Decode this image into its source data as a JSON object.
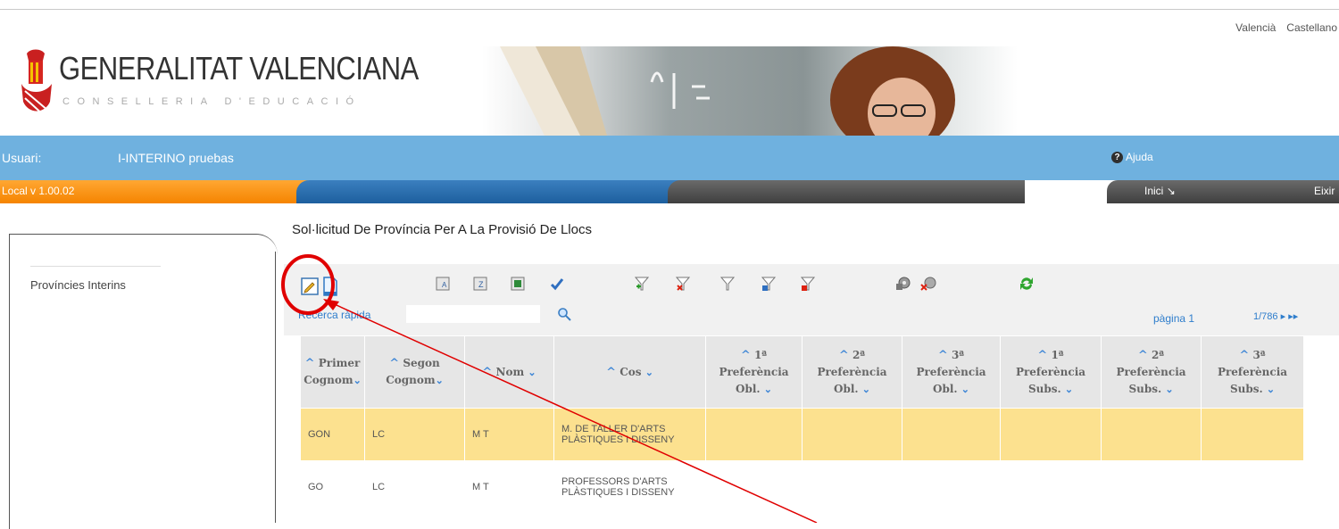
{
  "top": {
    "languages": [
      "Valencià",
      "Castellano"
    ]
  },
  "header": {
    "logo_title": "GENERALITAT VALENCIANA",
    "logo_subtitle": "CONSELLERIA D'EDUCACIÓ"
  },
  "userbar": {
    "user_label": "Usuari:",
    "user_name": "I-INTERINO pruebas",
    "help_label": "Ajuda"
  },
  "tabs": {
    "version": "Local v 1.00.02",
    "inici": "Inici",
    "eixir": "Eixir"
  },
  "sidebar": {
    "items": [
      {
        "label": "Províncies Interins"
      }
    ]
  },
  "main": {
    "title": "Sol·licitud De Província Per A La Provisió De Llocs"
  },
  "toolbar": {
    "icons": [
      "edit-icon",
      "new-document-icon",
      "export-icon",
      "sort-icon",
      "excel-icon",
      "check-icon",
      "filter-add-icon",
      "filter-remove-icon",
      "filter-icon",
      "filter-save-icon",
      "filter-delete-icon",
      "config-icon",
      "config-remove-icon",
      "refresh-icon"
    ],
    "search_label": "Recerca ràpida",
    "search_value": "",
    "page_label": "pàgina 1",
    "page_count": "1/786"
  },
  "table": {
    "columns": [
      {
        "line1": "Primer",
        "line2": "Cognom",
        "line3": ""
      },
      {
        "line1": "Segon",
        "line2": "Cognom",
        "line3": ""
      },
      {
        "line1": "Nom",
        "line2": "",
        "line3": ""
      },
      {
        "line1": "Cos",
        "line2": "",
        "line3": ""
      },
      {
        "line1": "1ª",
        "line2": "Preferència",
        "line3": "Obl."
      },
      {
        "line1": "2ª",
        "line2": "Preferència",
        "line3": "Obl."
      },
      {
        "line1": "3ª",
        "line2": "Preferència",
        "line3": "Obl."
      },
      {
        "line1": "1ª",
        "line2": "Preferència",
        "line3": "Subs."
      },
      {
        "line1": "2ª",
        "line2": "Preferència",
        "line3": "Subs."
      },
      {
        "line1": "3ª",
        "line2": "Preferència",
        "line3": "Subs."
      }
    ],
    "rows": [
      {
        "cells": [
          "GON",
          "LC",
          "M T",
          "M. DE TALLER D'ARTS PLÀSTIQUES I DISSENY",
          "",
          "",
          "",
          "",
          "",
          ""
        ],
        "selected": true
      },
      {
        "cells": [
          "GO",
          "LC",
          "M T",
          "PROFESSORS D'ARTS PLÀSTIQUES I DISSENY",
          "",
          "",
          "",
          "",
          "",
          ""
        ],
        "selected": false
      }
    ]
  },
  "colors": {
    "userbar_blue": "#6fb1df",
    "tab_orange": "#f58400",
    "selected_row": "#fce18f",
    "annotation_red": "#e00000"
  }
}
